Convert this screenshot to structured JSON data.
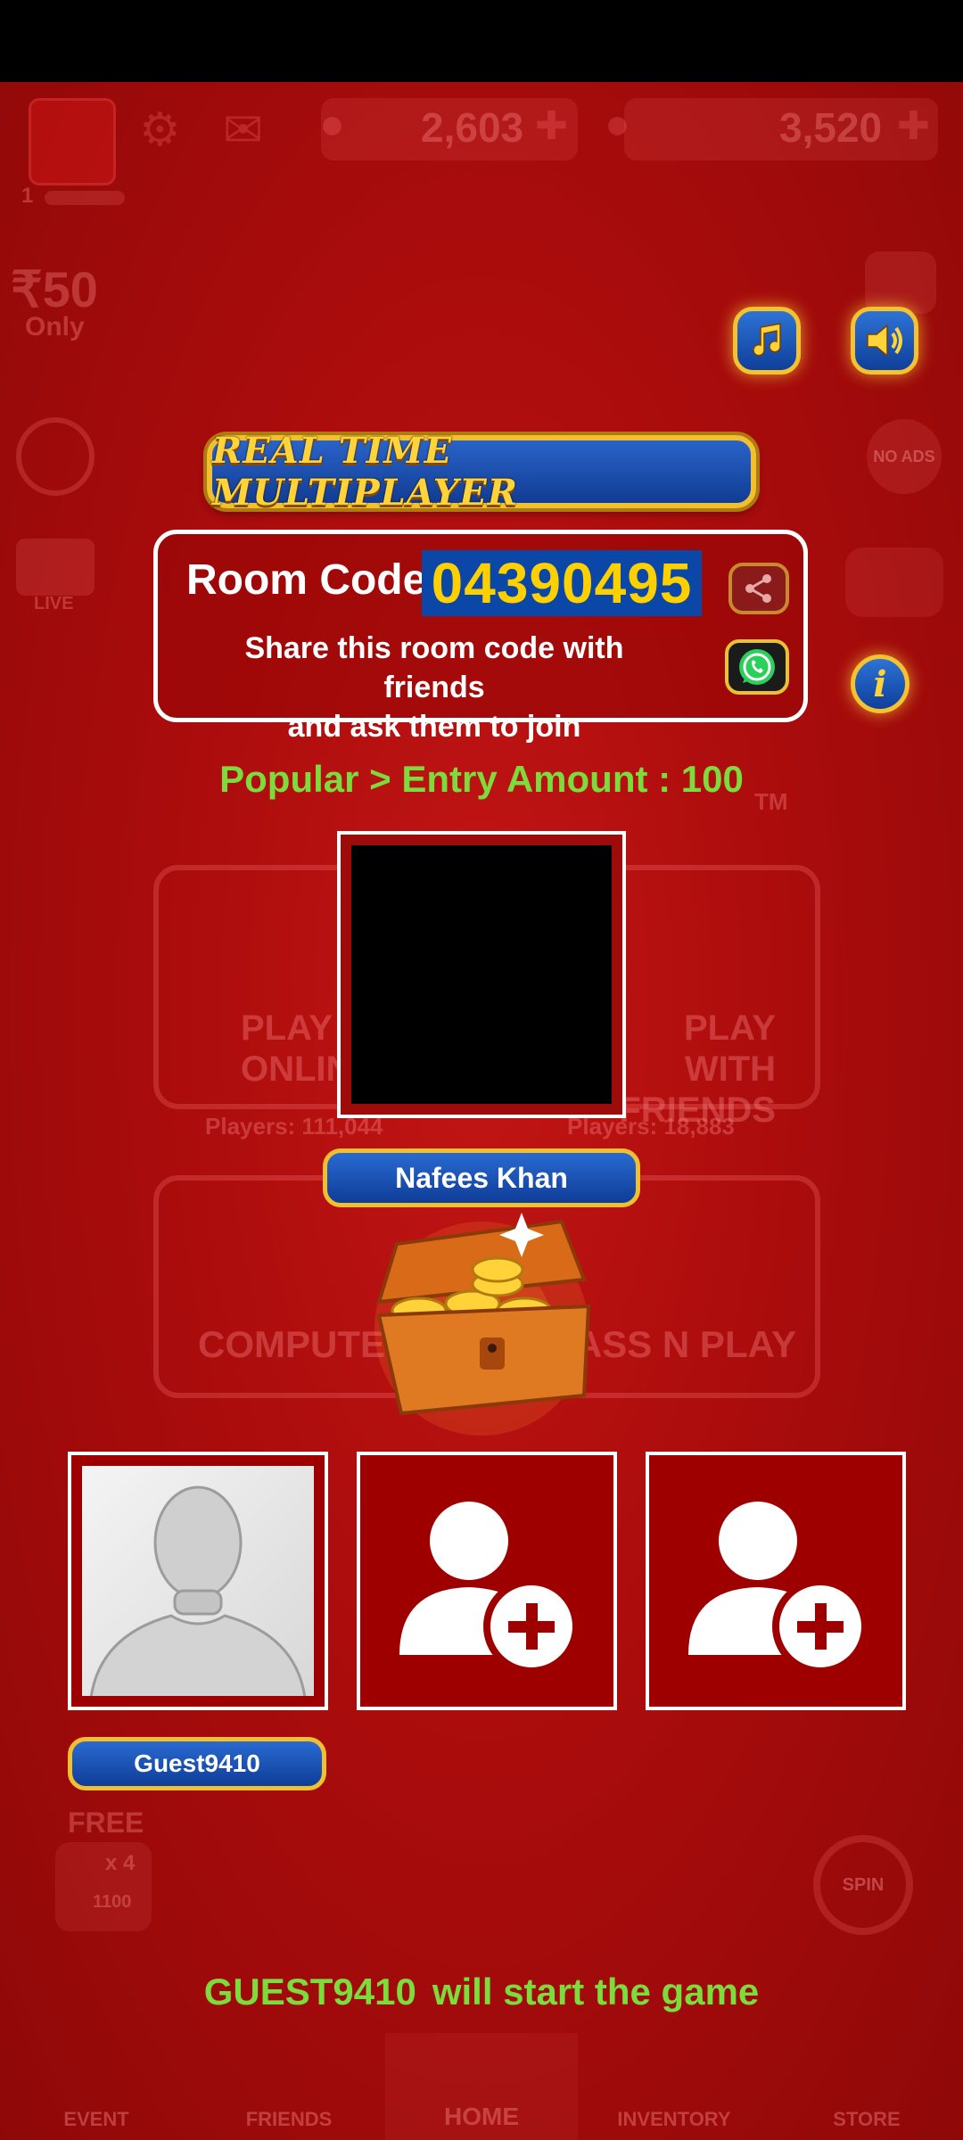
{
  "header": {
    "coins": "2,603",
    "gems": "3,520",
    "level": "1"
  },
  "promo": {
    "price": "₹50",
    "price_note": "Only",
    "live_label": "LIVE",
    "no_ads": "NO ADS"
  },
  "dialog": {
    "title": "REAL TIME MULTIPLAYER",
    "room_label": "Room Code :",
    "room_code": "04390495",
    "hint_line1": "Share this room code with friends",
    "hint_line2": "and ask them to join",
    "entry_line": "Popular > Entry Amount : 100",
    "host_name": "Nafees Khan"
  },
  "players": [
    {
      "name": "Guest9410",
      "type": "avatar"
    },
    {
      "type": "invite"
    },
    {
      "type": "invite"
    }
  ],
  "footer": {
    "guest": "GUEST9410",
    "message": "will start the game"
  },
  "background_menu": {
    "play_online": "PLAY ONLINE",
    "play_friends": "PLAY WITH FRIENDS",
    "online_players": "Players: 111,044",
    "friend_players": "Players: 18,883",
    "computer": "COMPUTER",
    "pass_n_play": "PASS N PLAY",
    "free": "FREE",
    "ad_count": "x 4",
    "ad_reward": "1100",
    "spin": "SPIN",
    "trademark": "TM"
  },
  "nav": [
    "EVENT",
    "FRIENDS",
    "HOME",
    "INVENTORY",
    "STORE"
  ],
  "colors": {
    "background": "#a50a0a",
    "accent_gold": "#f2c02f",
    "button_blue": "#1450b0",
    "highlight_green": "#7bdc3c",
    "code_yellow": "#ffd000"
  }
}
